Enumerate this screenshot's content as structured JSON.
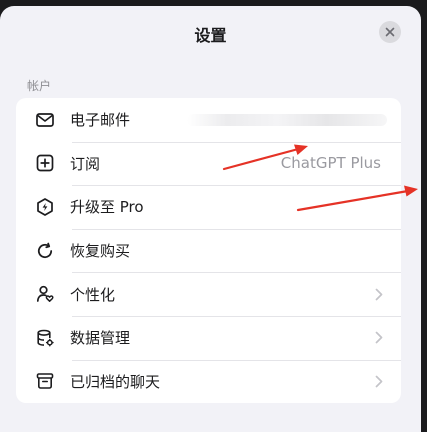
{
  "header": {
    "title": "设置"
  },
  "account_section": {
    "label": "帐户",
    "items": [
      {
        "label": "电子邮件",
        "icon": "mail-icon",
        "value": ""
      },
      {
        "label": "订阅",
        "icon": "plus-square-icon",
        "value": "ChatGPT Plus"
      },
      {
        "label": "升级至 Pro",
        "icon": "upgrade-icon",
        "value": ""
      },
      {
        "label": "恢复购买",
        "icon": "refresh-icon",
        "value": ""
      },
      {
        "label": "个性化",
        "icon": "personalize-icon",
        "value": ""
      },
      {
        "label": "数据管理",
        "icon": "database-icon",
        "value": ""
      },
      {
        "label": "已归档的聊天",
        "icon": "archive-icon",
        "value": ""
      }
    ]
  },
  "annotations": {
    "arrow_color": "#e53226"
  }
}
